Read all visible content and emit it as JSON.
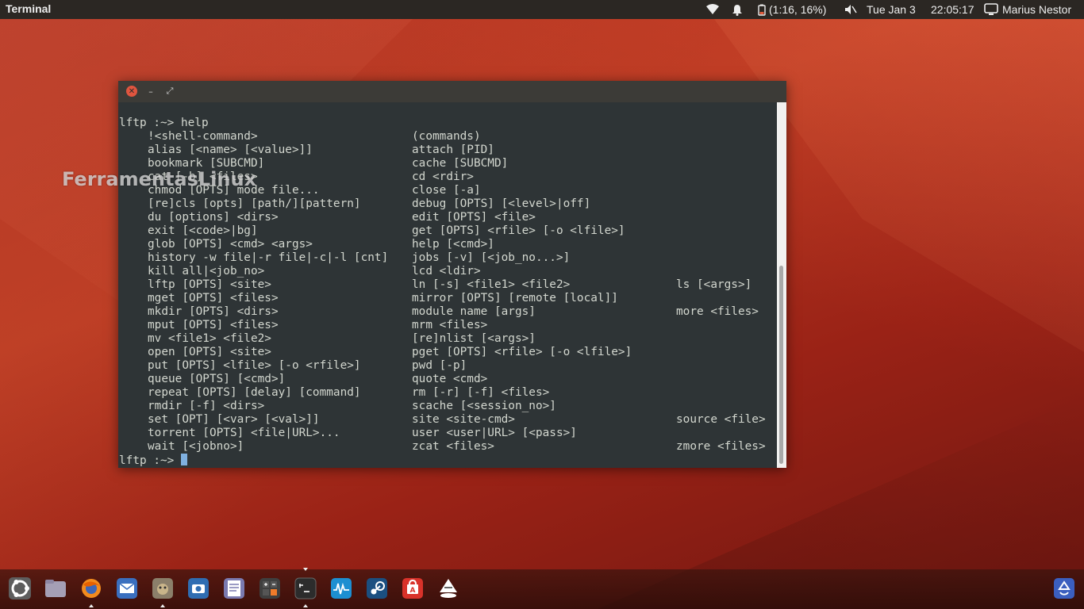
{
  "top_panel": {
    "app_title": "Terminal",
    "battery": "(1:16, 16%)",
    "date": "Tue Jan  3",
    "time": "22:05:17",
    "user": "Marius Nestor"
  },
  "watermark": "FerramentasLinux",
  "terminal": {
    "command_line": "lftp :~> help",
    "rows": [
      [
        "!<shell-command>",
        "(commands)",
        ""
      ],
      [
        "alias [<name> [<value>]]",
        "attach [PID]",
        ""
      ],
      [
        "bookmark [SUBCMD]",
        "cache [SUBCMD]",
        ""
      ],
      [
        "cat [-b] <files>",
        "cd <rdir>",
        ""
      ],
      [
        "chmod [OPTS] mode file...",
        "close [-a]",
        ""
      ],
      [
        "[re]cls [opts] [path/][pattern]",
        "debug [OPTS] [<level>|off]",
        ""
      ],
      [
        "du [options] <dirs>",
        "edit [OPTS] <file>",
        ""
      ],
      [
        "exit [<code>|bg]",
        "get [OPTS] <rfile> [-o <lfile>]",
        ""
      ],
      [
        "glob [OPTS] <cmd> <args>",
        "help [<cmd>]",
        ""
      ],
      [
        "history -w file|-r file|-c|-l [cnt]",
        "jobs [-v] [<job_no...>]",
        ""
      ],
      [
        "kill all|<job_no>",
        "lcd <ldir>",
        ""
      ],
      [
        "lftp [OPTS] <site>",
        "ln [-s] <file1> <file2>",
        "ls [<args>]"
      ],
      [
        "mget [OPTS] <files>",
        "mirror [OPTS] [remote [local]]",
        ""
      ],
      [
        "mkdir [OPTS] <dirs>",
        "module name [args]",
        "more <files>"
      ],
      [
        "mput [OPTS] <files>",
        "mrm <files>",
        ""
      ],
      [
        "mv <file1> <file2>",
        "[re]nlist [<args>]",
        ""
      ],
      [
        "open [OPTS] <site>",
        "pget [OPTS] <rfile> [-o <lfile>]",
        ""
      ],
      [
        "put [OPTS] <lfile> [-o <rfile>]",
        "pwd [-p]",
        ""
      ],
      [
        "queue [OPTS] [<cmd>]",
        "quote <cmd>",
        ""
      ],
      [
        "repeat [OPTS] [delay] [command]",
        "rm [-r] [-f] <files>",
        ""
      ],
      [
        "rmdir [-f] <dirs>",
        "scache [<session_no>]",
        ""
      ],
      [
        "set [OPT] [<var> [<val>]]",
        "site <site-cmd>",
        "source <file>"
      ],
      [
        "torrent [OPTS] <file|URL>...",
        "user <user|URL> [<pass>]",
        ""
      ],
      [
        "wait [<jobno>]",
        "zcat <files>",
        "zmore <files>"
      ]
    ],
    "prompt": "lftp :~> "
  },
  "launcher": [
    {
      "name": "ubuntu-dash-icon"
    },
    {
      "name": "files-icon"
    },
    {
      "name": "firefox-icon"
    },
    {
      "name": "mail-icon"
    },
    {
      "name": "gimp-icon"
    },
    {
      "name": "screenshot-icon"
    },
    {
      "name": "text-editor-icon"
    },
    {
      "name": "calculator-icon"
    },
    {
      "name": "terminal-icon"
    },
    {
      "name": "system-monitor-icon"
    },
    {
      "name": "steam-icon"
    },
    {
      "name": "software-center-icon"
    },
    {
      "name": "inkscape-icon"
    },
    {
      "name": "trash-icon"
    }
  ],
  "colors": {
    "panel_bg": "#2b2723",
    "terminal_bg": "#2e3436",
    "terminal_fg": "#d3d7cf",
    "close_button": "#e0553f"
  }
}
